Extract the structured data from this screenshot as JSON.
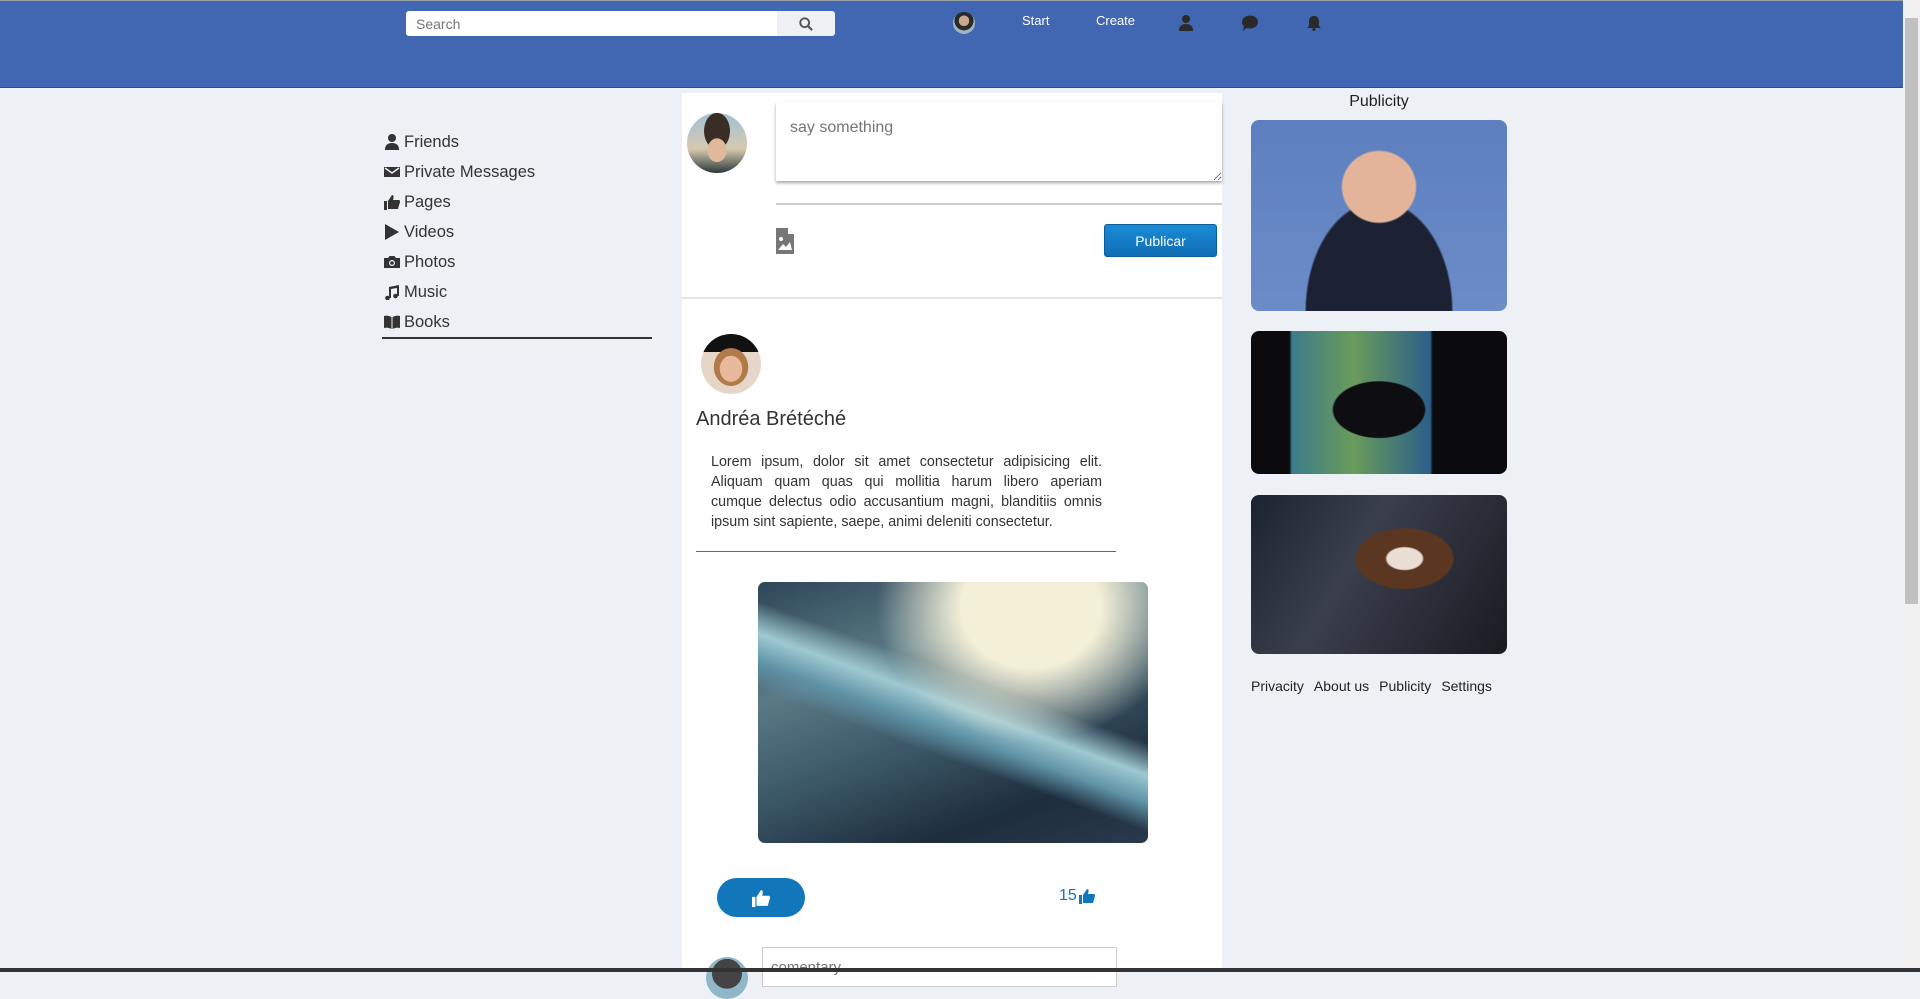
{
  "header": {
    "search_placeholder": "Search",
    "nav": {
      "start": "Start",
      "create": "Create"
    }
  },
  "sidebar": {
    "items": [
      {
        "label": "Friends",
        "icon": "user-icon"
      },
      {
        "label": "Private Messages",
        "icon": "envelope-icon"
      },
      {
        "label": "Pages",
        "icon": "thumbs-up-icon"
      },
      {
        "label": "Videos",
        "icon": "play-icon"
      },
      {
        "label": "Photos",
        "icon": "camera-icon"
      },
      {
        "label": "Music",
        "icon": "music-icon"
      },
      {
        "label": "Books",
        "icon": "book-icon"
      }
    ]
  },
  "composer": {
    "placeholder": "say something",
    "publish_label": "Publicar"
  },
  "post": {
    "author": "Andréa Brétéché",
    "text": "Lorem ipsum, dolor sit amet consectetur adipisicing elit. Aliquam quam quas qui mollitia harum libero aperiam cumque delectus odio accusantium magni, blanditiis omnis ipsum sint sapiente, saepe, animi deleniti consectetur.",
    "like_count": "15",
    "comment_placeholder": "comentary"
  },
  "right": {
    "title": "Publicity",
    "footer": [
      "Privacity",
      "About us",
      "Publicity",
      "Settings"
    ]
  },
  "colors": {
    "header": "#4267b2",
    "accent": "#1277ba",
    "background": "#edf0f5"
  }
}
